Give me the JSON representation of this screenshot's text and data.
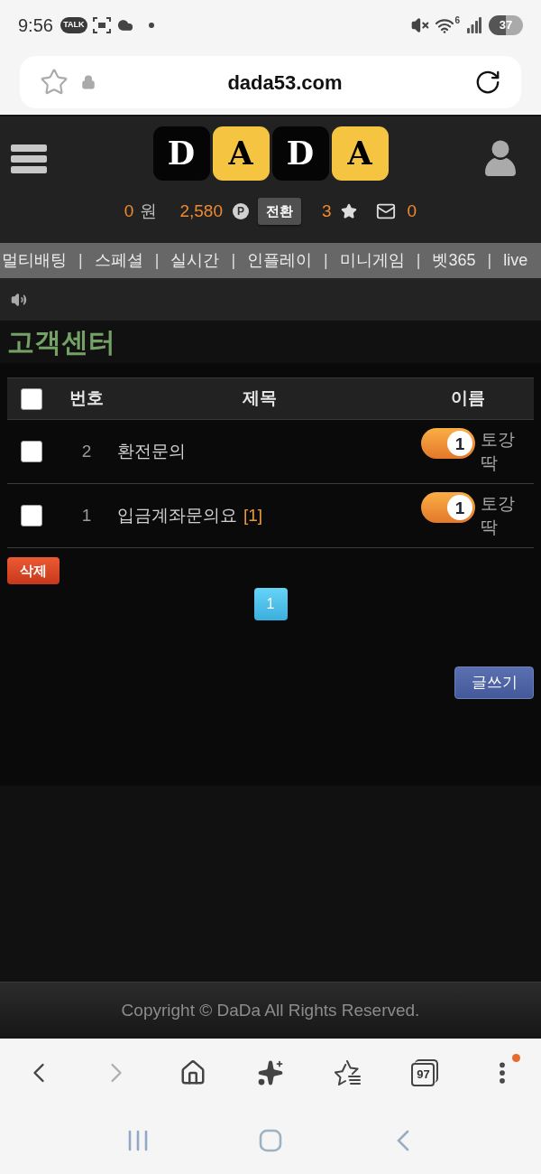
{
  "status_bar": {
    "time": "9:56",
    "talk_badge": "TALK",
    "wifi_badge": "6",
    "battery": "37"
  },
  "address_bar": {
    "url": "dada53.com"
  },
  "header": {
    "logo": [
      {
        "letter": "D",
        "color": "#050505"
      },
      {
        "letter": "A",
        "color": "#f5c440"
      },
      {
        "letter": "D",
        "color": "#050505"
      },
      {
        "letter": "A",
        "color": "#f5c440"
      }
    ],
    "balance": {
      "amount": "0",
      "unit": "원"
    },
    "points": {
      "amount": "2,580",
      "badge": "P"
    },
    "convert_button": "전환",
    "stars": "3",
    "messages": "0"
  },
  "nav": [
    {
      "kind": "link",
      "label": "멀티배팅"
    },
    {
      "kind": "separator",
      "label": "|"
    },
    {
      "kind": "link",
      "label": "스페셜"
    },
    {
      "kind": "separator",
      "label": "|"
    },
    {
      "kind": "link",
      "label": "실시간"
    },
    {
      "kind": "separator",
      "label": "|"
    },
    {
      "kind": "link",
      "label": "인플레이"
    },
    {
      "kind": "separator",
      "label": "|"
    },
    {
      "kind": "link",
      "label": "미니게임"
    },
    {
      "kind": "separator",
      "label": "|"
    },
    {
      "kind": "link",
      "label": "벳365"
    },
    {
      "kind": "separator",
      "label": "|"
    },
    {
      "kind": "link",
      "label": "live"
    }
  ],
  "page_title": "고객센터",
  "table": {
    "columns": [
      {
        "kind": "checkbox",
        "checked": false
      },
      {
        "kind": "text",
        "label": "번호"
      },
      {
        "kind": "text",
        "label": "제목"
      },
      {
        "kind": "text",
        "label": "이름"
      }
    ],
    "rows": [
      {
        "checked": false,
        "number": "2",
        "title": "환전문의",
        "level": "1",
        "author": "토강딱"
      },
      {
        "checked": false,
        "number": "1",
        "title": "입금계좌문의요",
        "comments": "[1]",
        "level": "1",
        "author": "토강딱"
      }
    ]
  },
  "delete_button": "삭제",
  "pagination": [
    {
      "label": "1",
      "selected": true
    }
  ],
  "write_button": "글쓰기",
  "footer": "Copyright © DaDa All Rights Reserved.",
  "browser_toolbar": {
    "forward_disabled": true,
    "tab_count": "97",
    "menu_notification": true
  }
}
